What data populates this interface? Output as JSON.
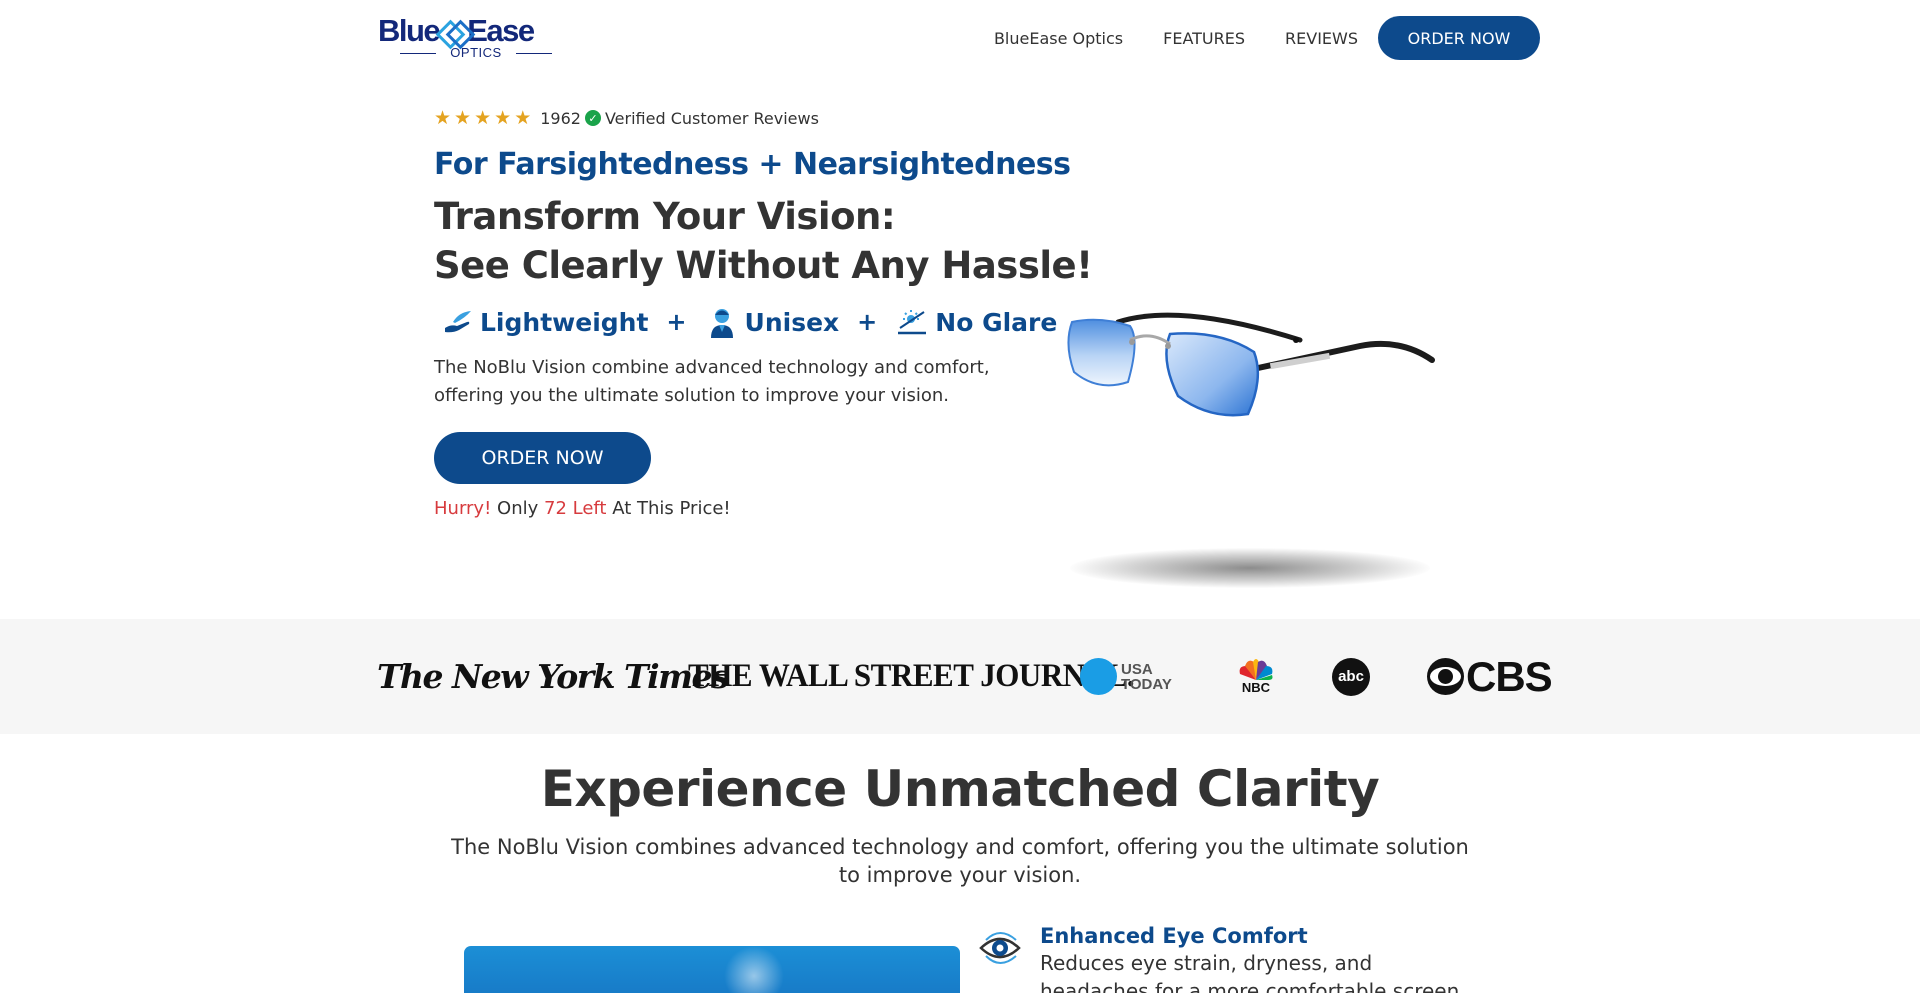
{
  "header": {
    "logo": {
      "word1": "Blue",
      "word2": "Ease",
      "sub": "OPTICS"
    },
    "nav": [
      "BlueEase Optics",
      "FEATURES",
      "REVIEWS"
    ],
    "order_label": "ORDER NOW"
  },
  "hero": {
    "rating": {
      "stars": 5,
      "count": "1962",
      "verified_label": "Verified Customer Reviews"
    },
    "eyebrow": "For Farsightedness + Nearsightedness",
    "headline_line1": "Transform Your Vision:",
    "headline_line2": "See Clearly Without Any Hassle!",
    "features": [
      {
        "icon": "feather-hand-icon",
        "label": "Lightweight"
      },
      {
        "icon": "person-icon",
        "label": "Unisex"
      },
      {
        "icon": "sun-glare-icon",
        "label": "No Glare"
      }
    ],
    "plus": "+",
    "description": "The NoBlu Vision combine advanced technology and comfort, offering you the ultimate solution to improve your vision.",
    "cta_label": "ORDER NOW",
    "urgency": {
      "hurry": "Hurry!",
      "only": "Only",
      "left": "72 Left",
      "suffix": "At This Price!"
    }
  },
  "press": {
    "nyt": "The New York Times",
    "wsj": "THE WALL STREET JOURNAL.",
    "usa": [
      "USA",
      "TODAY"
    ],
    "nbc": "NBC",
    "abc": "abc",
    "cbs": "CBS"
  },
  "clarity": {
    "title": "Experience Unmatched Clarity",
    "description": "The NoBlu Vision combines advanced technology and comfort, offering you the ultimate solution to improve your vision.",
    "benefit_title": "Enhanced Eye Comfort",
    "benefit_text": "Reduces eye strain, dryness, and headaches for a more comfortable screen experience."
  },
  "colors": {
    "brand_navy": "#0d4a8c",
    "logo_navy": "#13287a",
    "star_gold": "#e4a321",
    "urgency_red": "#d73b3e",
    "verified_green": "#1aa34a"
  }
}
